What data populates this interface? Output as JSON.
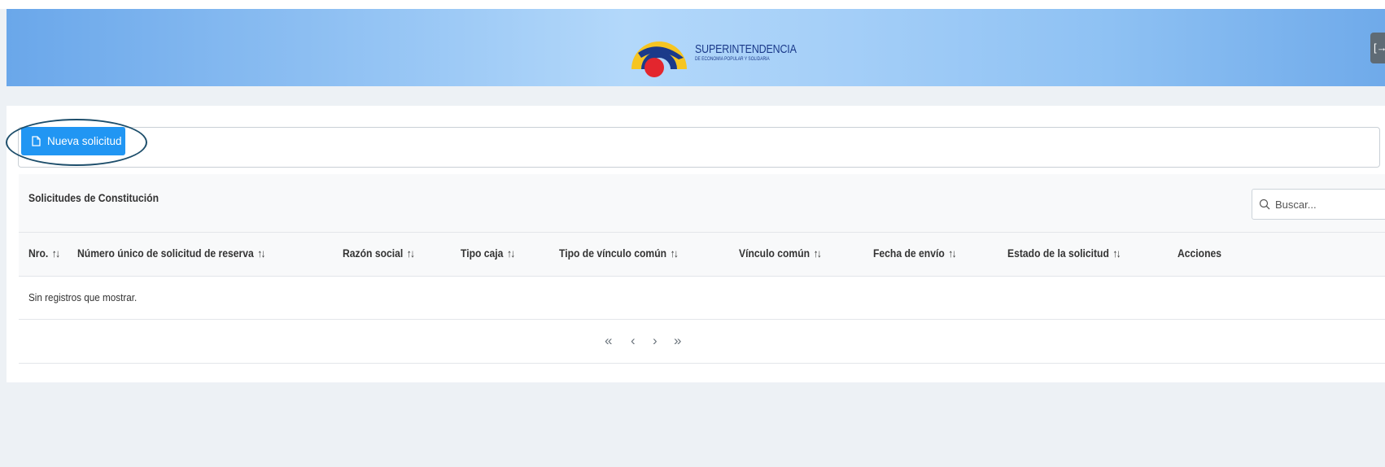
{
  "header": {
    "logo_title": "SUPERINTENDENCIA",
    "logo_subtitle": "DE ECONOMÍA POPULAR Y SOLIDARIA",
    "logout_icon": "logout-icon"
  },
  "toolbar": {
    "new_button_label": "Nueva solicitud",
    "new_button_icon": "file-icon"
  },
  "table": {
    "title": "Solicitudes de Constitución",
    "search_placeholder": "Buscar...",
    "sort_glyph": "↑↓",
    "columns": [
      {
        "label": "Nro."
      },
      {
        "label": "Número único de solicitud de reserva"
      },
      {
        "label": "Razón social"
      },
      {
        "label": "Tipo caja"
      },
      {
        "label": "Tipo de vínculo común"
      },
      {
        "label": "Vínculo común"
      },
      {
        "label": "Fecha de envío"
      },
      {
        "label": "Estado de la solicitud"
      },
      {
        "label": "Acciones"
      }
    ],
    "empty_message": "Sin registros que mostrar.",
    "paginator": {
      "first": "«",
      "prev": "‹",
      "next": "›",
      "last": "»"
    }
  },
  "colors": {
    "primary": "#2196f3",
    "highlight": "#1d4e6b",
    "logo_yellow": "#f6c521",
    "logo_blue": "#1b3a8a",
    "logo_red": "#e3262e"
  }
}
